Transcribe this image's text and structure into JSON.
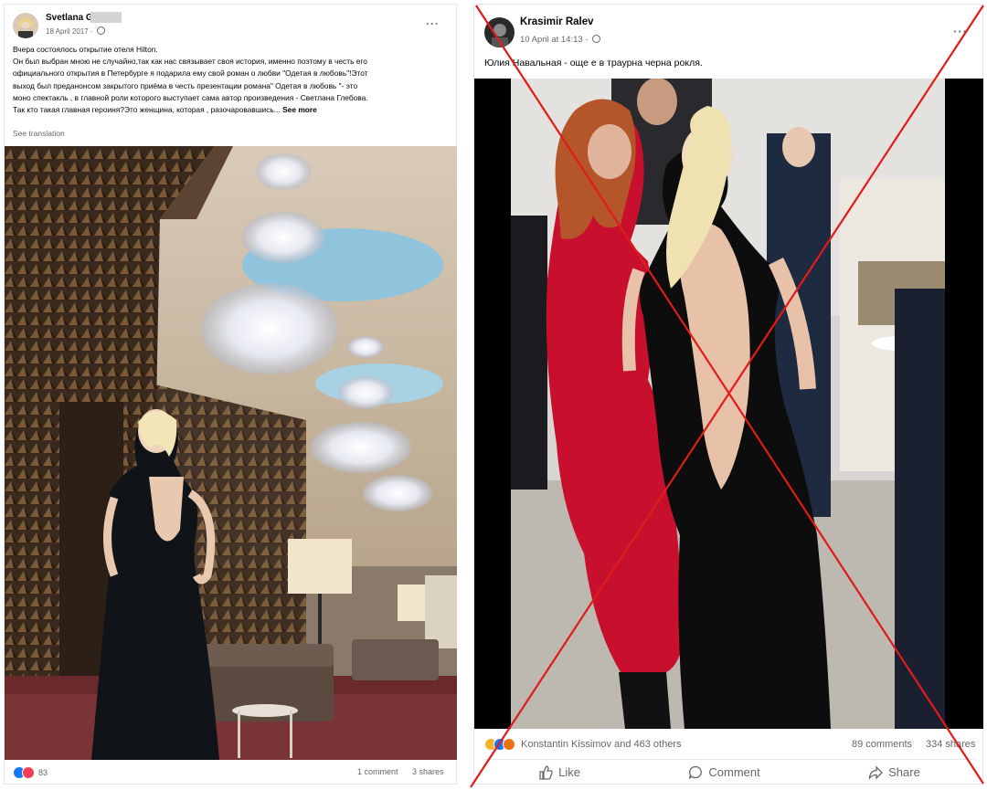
{
  "colors": {
    "accent": "#1877f2",
    "text": "#050505",
    "muted": "#65676b",
    "cross": "#e01b1b",
    "dress_red": "#c8102e"
  },
  "left_post": {
    "author": "Svetlana Gl",
    "date": "18 April 2017",
    "text_lines": [
      "Вчера состоялось открытие отеля Hilton.",
      "Он был выбран мною не случайно,так как нас связывает своя история, именно поэтому в честь его",
      "официального открытия в Петербурге я подарила ему свой роман о любви \"Одетая в любовь\"!Этот",
      "выход был преданонсом закрытого приёма в честь презентации романа\" Одетая в любовь \"- это",
      "моно спектакль , в главной роли которого выступает сама автор произведения - Светлана Глебова.",
      "Так кто такая главная героиня?Это женщина, которая , разочаровавшись..."
    ],
    "see_more": "See more",
    "see_translation": "See translation",
    "reaction_count": "83",
    "comments": "1 comment",
    "shares": "3 shares",
    "more_icon": "ellipsis-icon"
  },
  "right_post": {
    "author": "Krasimir Ralev",
    "date": "10 April at 14:13",
    "text": "Юлия Навальная - още е в траурна черна рокля.",
    "reactions_text": "Konstantin Kissimov and 463 others",
    "comments": "89 comments",
    "shares": "334 shares",
    "actions": {
      "like": "Like",
      "comment": "Comment",
      "share": "Share"
    },
    "more_icon": "ellipsis-icon"
  }
}
